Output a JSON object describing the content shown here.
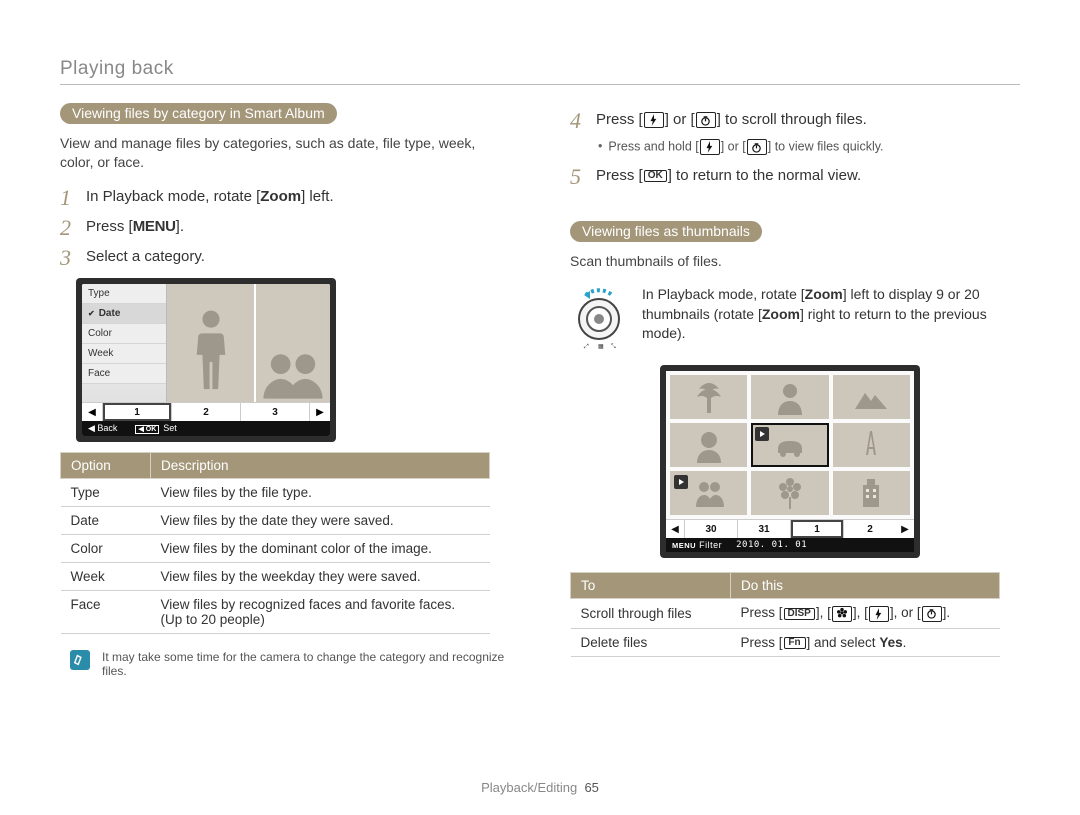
{
  "header": {
    "section": "Playing back"
  },
  "left": {
    "pill": "Viewing files by category in Smart Album",
    "intro": "View and manage files by categories, such as date, file type, week, color, or face.",
    "step1_pre": "In Playback mode, rotate [",
    "step1_bold": "Zoom",
    "step1_post": "] left.",
    "step2_pre": "Press [",
    "step2_key": "MENU",
    "step2_post": "].",
    "step3": "Select a category.",
    "menu": {
      "type": "Type",
      "date": "Date",
      "color": "Color",
      "week": "Week",
      "face": "Face"
    },
    "strip": {
      "c1": "1",
      "c2": "2",
      "c3": "3"
    },
    "status": {
      "back": "Back",
      "set": "Set"
    },
    "table": {
      "h1": "Option",
      "h2": "Description",
      "rows": [
        {
          "o": "Type",
          "d": "View files by the file type."
        },
        {
          "o": "Date",
          "d": "View files by the date they were saved."
        },
        {
          "o": "Color",
          "d": "View files by the dominant color of the image."
        },
        {
          "o": "Week",
          "d": "View files by the weekday they were saved."
        },
        {
          "o": "Face",
          "d": "View files by recognized faces and favorite faces. (Up to 20 people)"
        }
      ]
    },
    "note": "It may take some time for the camera to change the category and recognize files."
  },
  "right": {
    "step4_pre": "Press [",
    "step4_mid": "] or [",
    "step4_post": "] to scroll through files.",
    "step4_bullet_pre": "Press and hold [",
    "step4_bullet_mid": "] or [",
    "step4_bullet_post": "] to view files quickly.",
    "step5_pre": "Press [",
    "step5_key": "OK",
    "step5_post": "] to return to the normal view.",
    "pill": "Viewing files as thumbnails",
    "intro": "Scan thumbnails of files.",
    "zoom_pre": "In Playback mode, rotate [",
    "zoom_b1": "Zoom",
    "zoom_mid": "] left to display 9 or 20 thumbnails (rotate [",
    "zoom_b2": "Zoom",
    "zoom_post": "] right to return to the previous mode).",
    "strip": {
      "c1": "30",
      "c2": "31",
      "c3": "1",
      "c4": "2"
    },
    "status": {
      "filter_label": "MENU",
      "filter": "Filter",
      "date": "2010. 01. 01"
    },
    "table": {
      "h1": "To",
      "h2": "Do this",
      "r1_to": "Scroll through ﬁles",
      "r1_do_pre": "Press [",
      "r1_do_k1": "DISP",
      "r1_do_sep": "], [",
      "r1_do_or": "], or [",
      "r1_do_end": "].",
      "r2_to": "Delete ﬁles",
      "r2_do_pre": "Press [",
      "r2_do_k": "Fn",
      "r2_do_mid": "] and select ",
      "r2_do_b": "Yes",
      "r2_do_end": "."
    }
  },
  "footer": {
    "section": "Playback/Editing",
    "page": "65"
  }
}
